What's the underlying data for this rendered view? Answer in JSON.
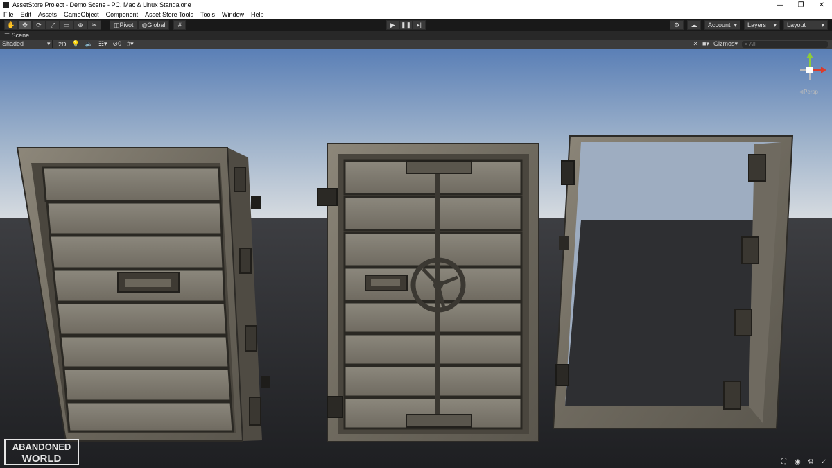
{
  "window": {
    "title": "AssetStore Project - Demo Scene - PC, Mac & Linux Standalone",
    "minimize": "—",
    "maximize": "❐",
    "close": "✕"
  },
  "menu": [
    "File",
    "Edit",
    "Assets",
    "GameObject",
    "Component",
    "Asset Store Tools",
    "Tools",
    "Window",
    "Help"
  ],
  "toolbar": {
    "pivot_label": "Pivot",
    "global_label": "Global",
    "account_label": "Account",
    "layers_label": "Layers",
    "layout_label": "Layout"
  },
  "scene": {
    "tab_label": "Scene",
    "draw_mode": "Shaded",
    "mode_2d": "2D",
    "hidden_count": "0",
    "gizmos_label": "Gizmos",
    "search_placeholder": "All",
    "projection_label": "Persp"
  },
  "watermark": {
    "line1": "ABANDONED",
    "line2": "WORLD"
  },
  "icons": [
    "hand-tool-icon",
    "move-tool-icon",
    "rotate-tool-icon",
    "scale-tool-icon",
    "rect-tool-icon",
    "transform-tool-icon",
    "custom-tool-icon",
    "grid-snap-icon",
    "play-icon",
    "pause-icon",
    "step-icon",
    "services-icon",
    "cloud-icon",
    "lighting-icon",
    "audio-icon",
    "effects-icon",
    "visibility-icon",
    "camera-icon"
  ],
  "colors": {
    "sky_top": "#5a7fb6",
    "sky_horizon": "#d6dbe0",
    "ground": "#2f3033",
    "toolbar_bg": "#191919",
    "gizmo_y": "#8ecc3a",
    "gizmo_x": "#db3b2b"
  }
}
